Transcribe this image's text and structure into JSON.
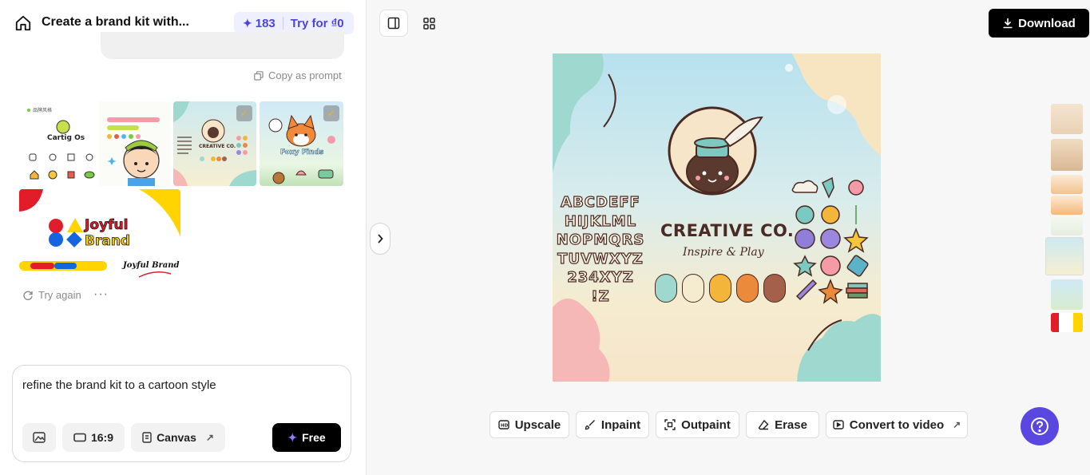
{
  "header": {
    "title": "Create a brand kit with...",
    "credits": "183",
    "try_label": "Try for ₫0"
  },
  "chat": {
    "copy_prompt": "Copy as prompt",
    "try_again": "Try again",
    "more": "···"
  },
  "thumbnails": {
    "t1_brand": "Cartig Os",
    "t1_caption": "品牌风格",
    "t2_brand": "CREATIVE CO.",
    "t3_brand": "Foxy Finds",
    "t4_brand_line1": "Joyful",
    "t4_brand_line2": "Brand",
    "t4_signature": "Joyful Brand"
  },
  "composer": {
    "text": "refine the brand kit to a cartoon style",
    "ratio_label": "16:9",
    "canvas_label": "Canvas",
    "submit_label": "Free"
  },
  "toolbar": {
    "download_label": "Download"
  },
  "canvas": {
    "brand_name": "CREATIVE CO.",
    "tagline": "Inspire & Play",
    "alphabet": "ABCDEFF\nHIJKLML\nNOPMQRS\nTUVWXYZ\n234XYZ\n!Z",
    "swatches": [
      "#9fd8cf",
      "#f5ecd0",
      "#f4b63a",
      "#ea8a3a",
      "#a4604a"
    ]
  },
  "actions": {
    "upscale": "Upscale",
    "inpaint": "Inpaint",
    "outpaint": "Outpaint",
    "erase": "Erase",
    "convert": "Convert to video"
  },
  "colors": {
    "accent": "#4b44e0",
    "help_button": "#5a46e0",
    "primary_button": "#000000"
  }
}
